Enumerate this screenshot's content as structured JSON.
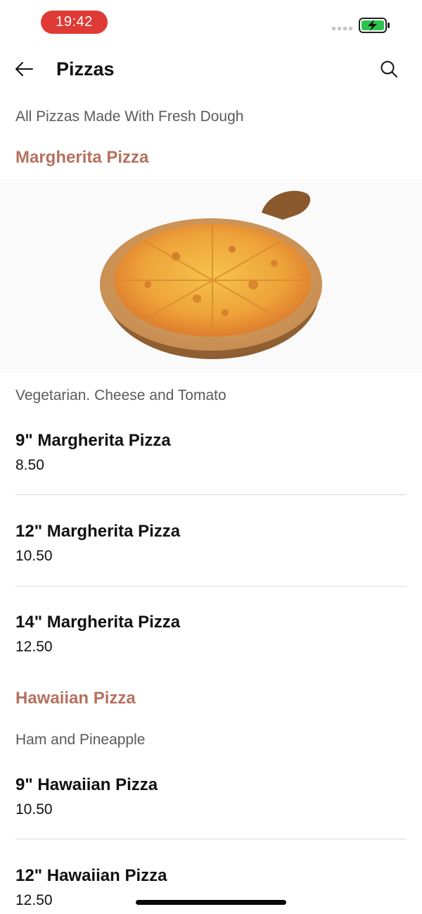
{
  "status_bar": {
    "time": "19:42",
    "signal_icon": "signal-dots-icon",
    "battery_icon": "battery-charging-icon",
    "battery_color": "#2ec24f",
    "time_pill_color": "#e03a36"
  },
  "nav": {
    "title": "Pizzas",
    "back_icon": "arrow-left-icon",
    "search_icon": "search-icon"
  },
  "menu": {
    "intro": "All Pizzas Made With Fresh Dough",
    "accent_color": "#b5715f",
    "categories": [
      {
        "title": "Margherita Pizza",
        "image_icon": "pizza-image",
        "description": "Vegetarian. Cheese and Tomato",
        "items": [
          {
            "name": "9\" Margherita Pizza",
            "price": "8.50"
          },
          {
            "name": "12\" Margherita Pizza",
            "price": "10.50"
          },
          {
            "name": "14\" Margherita Pizza",
            "price": "12.50"
          }
        ]
      },
      {
        "title": "Hawaiian Pizza",
        "description": "Ham and Pineapple",
        "items": [
          {
            "name": "9\" Hawaiian Pizza",
            "price": "10.50"
          },
          {
            "name": "12\" Hawaiian Pizza",
            "price": "12.50"
          }
        ]
      }
    ]
  }
}
